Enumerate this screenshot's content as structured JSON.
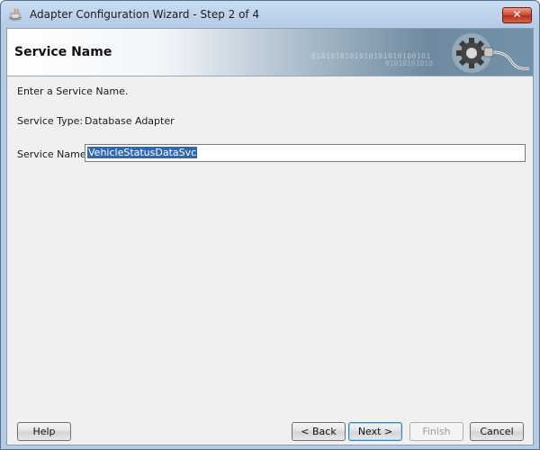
{
  "window": {
    "title": "Adapter Configuration Wizard - Step 2 of 4",
    "close_label": "✕"
  },
  "banner": {
    "title": "Service Name",
    "icon": "gear-plug-icon"
  },
  "main": {
    "intro": "Enter a Service Name.",
    "service_type_label": "Service Type:",
    "service_type_value": "Database Adapter",
    "service_name_label": "Service Name:",
    "service_name_value": "VehicleStatusDataSvc"
  },
  "footer": {
    "help_label": "Help",
    "back_label": "< Back",
    "next_label": "Next >",
    "finish_label": "Finish",
    "cancel_label": "Cancel",
    "finish_disabled": true
  },
  "colors": {
    "selection": "#3268b0",
    "close_button": "#c7432b"
  }
}
